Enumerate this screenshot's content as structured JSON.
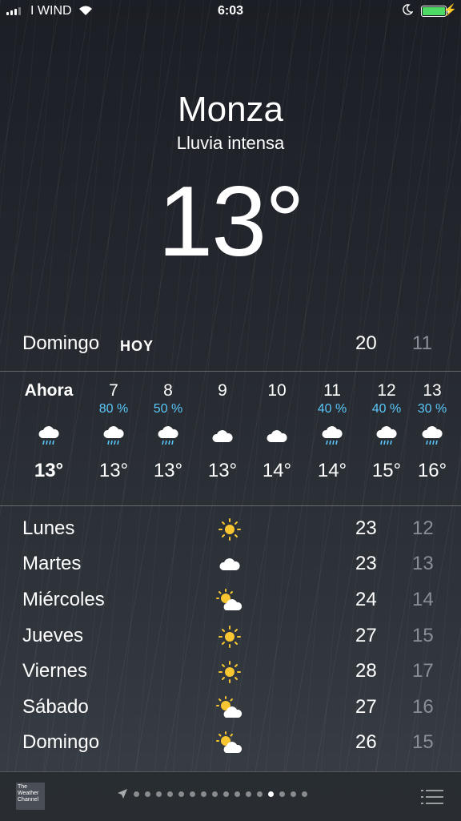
{
  "status": {
    "carrier": "I WIND",
    "time": "6:03"
  },
  "location": {
    "city": "Monza",
    "condition": "Lluvia intensa",
    "temp": "13°"
  },
  "today": {
    "day": "Domingo",
    "label": "HOY",
    "high": "20",
    "low": "11"
  },
  "hourly": [
    {
      "hour": "Ahora",
      "precip": "",
      "icon": "rain-cloud-icon",
      "temp": "13°"
    },
    {
      "hour": "7",
      "precip": "80 %",
      "icon": "rain-cloud-icon",
      "temp": "13°"
    },
    {
      "hour": "8",
      "precip": "50 %",
      "icon": "rain-cloud-icon",
      "temp": "13°"
    },
    {
      "hour": "9",
      "precip": "",
      "icon": "cloud-icon",
      "temp": "13°"
    },
    {
      "hour": "10",
      "precip": "",
      "icon": "cloud-icon",
      "temp": "14°"
    },
    {
      "hour": "11",
      "precip": "40 %",
      "icon": "rain-cloud-icon",
      "temp": "14°"
    },
    {
      "hour": "12",
      "precip": "40 %",
      "icon": "rain-cloud-icon",
      "temp": "15°"
    },
    {
      "hour": "13",
      "precip": "30 %",
      "icon": "rain-cloud-icon",
      "temp": "16°"
    }
  ],
  "daily": [
    {
      "day": "Lunes",
      "icon": "sun-icon",
      "high": "23",
      "low": "12"
    },
    {
      "day": "Martes",
      "icon": "cloud-icon",
      "high": "23",
      "low": "13"
    },
    {
      "day": "Miércoles",
      "icon": "partly-cloudy-icon",
      "high": "24",
      "low": "14"
    },
    {
      "day": "Jueves",
      "icon": "sun-icon",
      "high": "27",
      "low": "15"
    },
    {
      "day": "Viernes",
      "icon": "sun-icon",
      "high": "28",
      "low": "17"
    },
    {
      "day": "Sábado",
      "icon": "partly-cloudy-icon",
      "high": "27",
      "low": "16"
    },
    {
      "day": "Domingo",
      "icon": "partly-cloudy-icon",
      "high": "26",
      "low": "15"
    }
  ],
  "footer": {
    "logo": "The Weather Channel",
    "pages": 16,
    "active_page": 12
  },
  "colors": {
    "precip": "#5ac8fa",
    "sun": "#f7c531",
    "battery": "#4cd964",
    "low_temp": "#8a8f97"
  }
}
